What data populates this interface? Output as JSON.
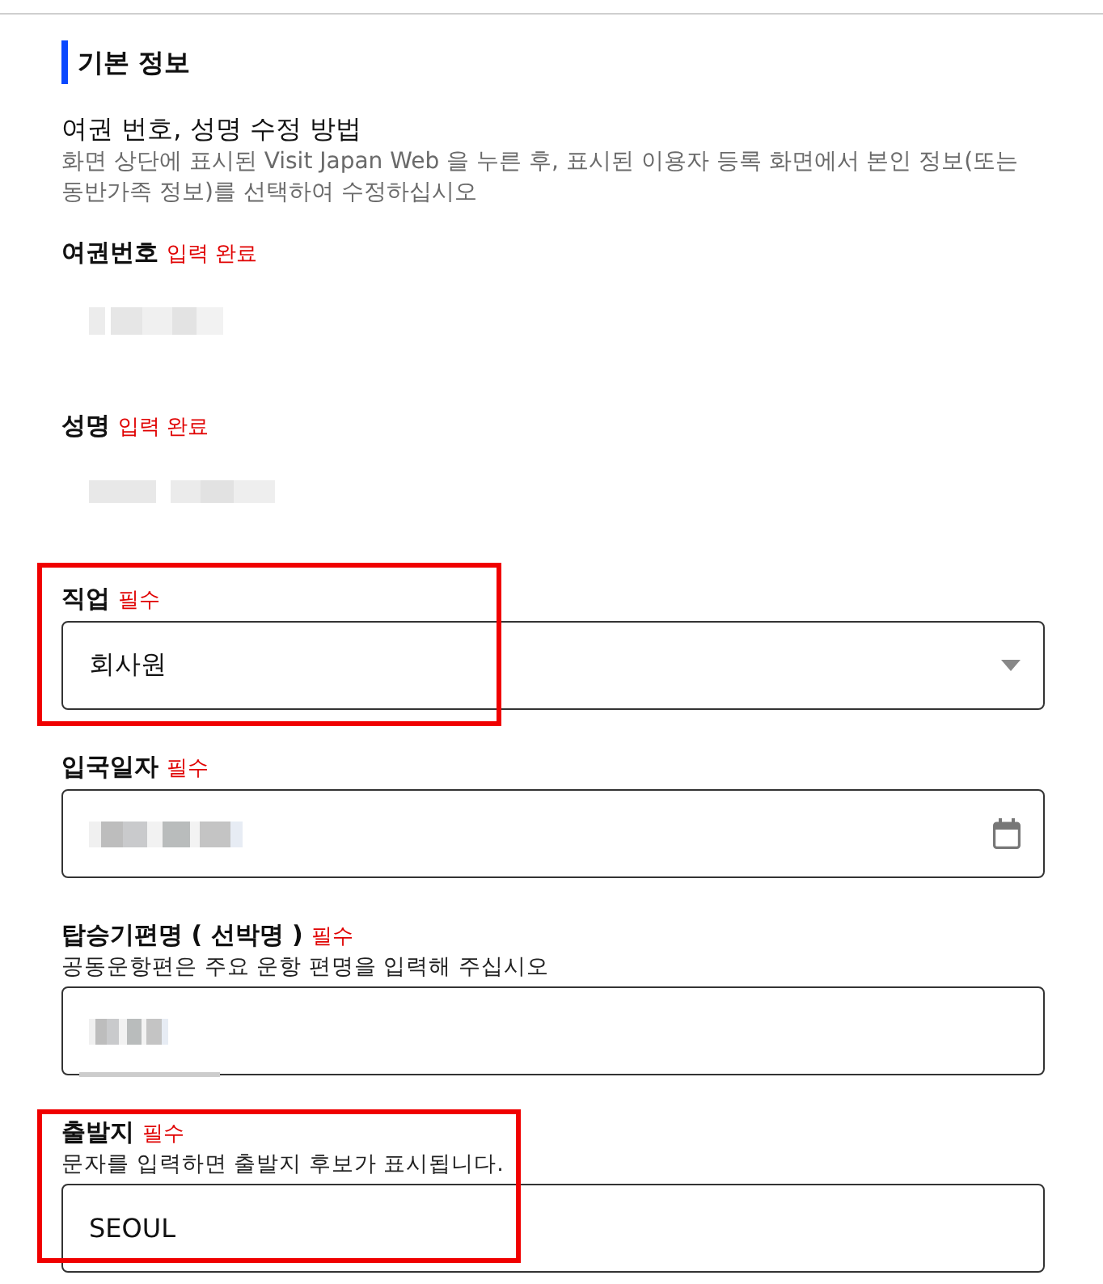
{
  "section": {
    "title": "기본 정보"
  },
  "help": {
    "title": "여권 번호, 성명 수정 방법",
    "text": "화면 상단에 표시된 Visit Japan Web 을 누른 후, 표시된 이용자 등록 화면에서 본인 정보(또는 동반가족 정보)를 선택하여 수정하십시오"
  },
  "fields": [
    {
      "kind": "readonly",
      "label": "여권번호",
      "status": "입력 완료",
      "redacted": true
    },
    {
      "kind": "readonly",
      "label": "성명",
      "status": "입력 완료",
      "redacted": true
    },
    {
      "kind": "select",
      "label": "직업",
      "status": "필수",
      "value": "회사원",
      "highlighted": true
    },
    {
      "kind": "date",
      "label": "입국일자",
      "status": "필수",
      "redacted": true
    },
    {
      "kind": "text",
      "label": "탑승기편명 ( 선박명 )",
      "status": "필수",
      "hint": "공동운항편은 주요 운항 편명을 입력해 주십시오",
      "redacted": true,
      "scrollbar": true
    },
    {
      "kind": "text",
      "label": "출발지",
      "status": "필수",
      "hint": "문자를 입력하면 출발지 후보가 표시됩니다.",
      "value": "SEOUL",
      "highlighted": true
    }
  ]
}
